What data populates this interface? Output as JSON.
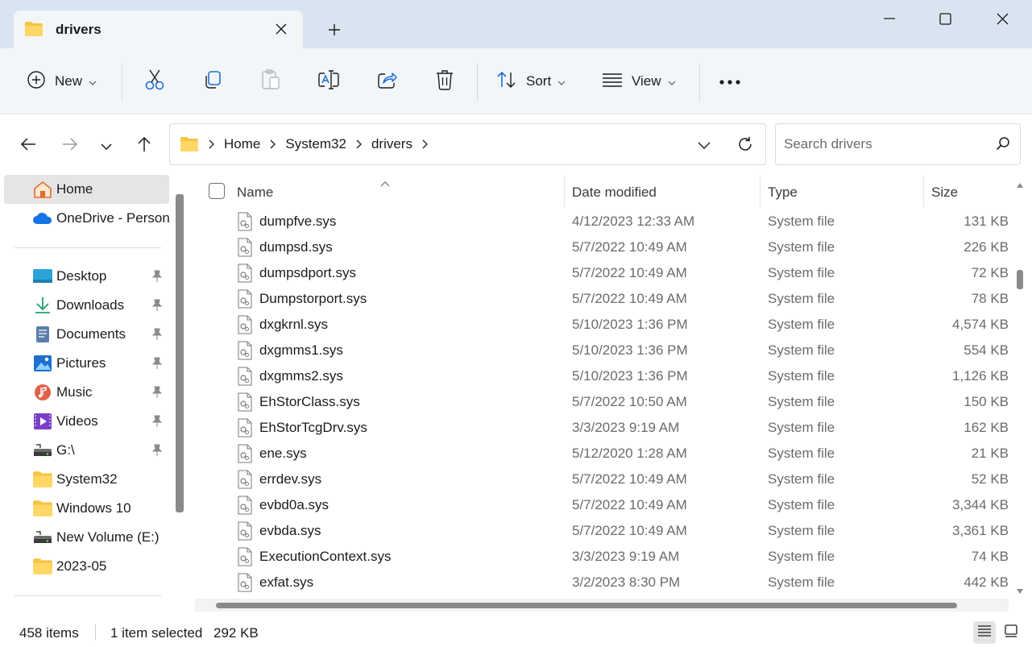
{
  "tab": {
    "title": "drivers"
  },
  "window": {
    "minimize_icon": "minimize-icon",
    "maximize_icon": "maximize-icon",
    "close_icon": "close-icon"
  },
  "toolbar": {
    "new_label": "New",
    "sort_label": "Sort",
    "view_label": "View",
    "icons": [
      "plus-circle-icon",
      "cut-icon",
      "copy-icon",
      "paste-icon",
      "rename-icon",
      "share-icon",
      "delete-icon",
      "sort-icon",
      "view-icon",
      "more-icon"
    ]
  },
  "breadcrumb": [
    "Home",
    "System32",
    "drivers"
  ],
  "search": {
    "placeholder": "Search drivers"
  },
  "sidebar": {
    "items": [
      {
        "label": "Home",
        "icon": "home-icon"
      },
      {
        "label": "OneDrive - Personal",
        "icon": "onedrive-icon"
      },
      {
        "label": "Desktop",
        "icon": "desktop-icon",
        "pinned": true
      },
      {
        "label": "Downloads",
        "icon": "downloads-icon",
        "pinned": true
      },
      {
        "label": "Documents",
        "icon": "documents-icon",
        "pinned": true
      },
      {
        "label": "Pictures",
        "icon": "pictures-icon",
        "pinned": true
      },
      {
        "label": "Music",
        "icon": "music-icon",
        "pinned": true
      },
      {
        "label": "Videos",
        "icon": "videos-icon",
        "pinned": true
      },
      {
        "label": "G:\\",
        "icon": "drive-icon",
        "pinned": true
      },
      {
        "label": "System32",
        "icon": "folder-icon"
      },
      {
        "label": "Windows 10",
        "icon": "folder-icon"
      },
      {
        "label": "New Volume (E:)",
        "icon": "drive-icon"
      },
      {
        "label": "2023-05",
        "icon": "folder-icon"
      }
    ]
  },
  "columns": {
    "name": "Name",
    "date": "Date modified",
    "type": "Type",
    "size": "Size"
  },
  "files": [
    {
      "name": "dumpfve.sys",
      "date": "4/12/2023 12:33 AM",
      "type": "System file",
      "size": "131 KB"
    },
    {
      "name": "dumpsd.sys",
      "date": "5/7/2022 10:49 AM",
      "type": "System file",
      "size": "226 KB"
    },
    {
      "name": "dumpsdport.sys",
      "date": "5/7/2022 10:49 AM",
      "type": "System file",
      "size": "72 KB"
    },
    {
      "name": "Dumpstorport.sys",
      "date": "5/7/2022 10:49 AM",
      "type": "System file",
      "size": "78 KB"
    },
    {
      "name": "dxgkrnl.sys",
      "date": "5/10/2023 1:36 PM",
      "type": "System file",
      "size": "4,574 KB"
    },
    {
      "name": "dxgmms1.sys",
      "date": "5/10/2023 1:36 PM",
      "type": "System file",
      "size": "554 KB"
    },
    {
      "name": "dxgmms2.sys",
      "date": "5/10/2023 1:36 PM",
      "type": "System file",
      "size": "1,126 KB"
    },
    {
      "name": "EhStorClass.sys",
      "date": "5/7/2022 10:50 AM",
      "type": "System file",
      "size": "150 KB"
    },
    {
      "name": "EhStorTcgDrv.sys",
      "date": "3/3/2023 9:19 AM",
      "type": "System file",
      "size": "162 KB"
    },
    {
      "name": "ene.sys",
      "date": "5/12/2020 1:28 AM",
      "type": "System file",
      "size": "21 KB"
    },
    {
      "name": "errdev.sys",
      "date": "5/7/2022 10:49 AM",
      "type": "System file",
      "size": "52 KB"
    },
    {
      "name": "evbd0a.sys",
      "date": "5/7/2022 10:49 AM",
      "type": "System file",
      "size": "3,344 KB"
    },
    {
      "name": "evbda.sys",
      "date": "5/7/2022 10:49 AM",
      "type": "System file",
      "size": "3,361 KB"
    },
    {
      "name": "ExecutionContext.sys",
      "date": "3/3/2023 9:19 AM",
      "type": "System file",
      "size": "74 KB"
    },
    {
      "name": "exfat.sys",
      "date": "3/2/2023 8:30 PM",
      "type": "System file",
      "size": "442 KB"
    }
  ],
  "status": {
    "items": "458 items",
    "selected": "1 item selected",
    "size": "292 KB"
  }
}
